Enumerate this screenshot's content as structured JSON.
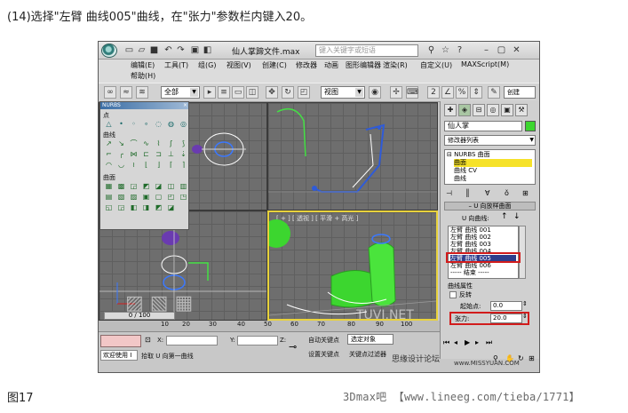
{
  "caption": "(14)选择\"左臂 曲线005\"曲线，在\"张力\"参数栏内键入20。",
  "figure_label": "图17",
  "footer_watermark": "3Dmax吧 【www.lineeg.com/tieba/1771】",
  "app": {
    "window_title": "仙人掌蹄文件.max",
    "search_placeholder": "键入关键字或短语",
    "menu_row1": [
      "编辑(E)",
      "工具(T)",
      "组(G)",
      "视图(V)",
      "创建(C)",
      "修改器",
      "动画",
      "图形编辑器",
      "渲染(R)",
      "自定义(U)",
      "MAXScript(M)"
    ],
    "menu_row2": [
      "帮助(H)"
    ],
    "toolbar": {
      "filter_dropdown": "全部",
      "viewport_dropdown": "视图",
      "named_selection": "创建"
    },
    "nurbs_panel": {
      "title": "NURBS",
      "close": "×",
      "section_point": "点",
      "section_curve": "曲线",
      "section_surface": "曲面"
    },
    "viewports": {
      "perspective_label": "[ + ] [ 透视 ] [ 平滑 + 高光 ]",
      "frame_counter": "0 / 100"
    },
    "command_panel": {
      "object_name": "仙人掌",
      "modifier_list": "修改器列表",
      "stack": [
        "NURBS 曲面",
        "曲面",
        "曲线 CV",
        "曲线"
      ],
      "stack_selected_index": 1,
      "rollout_title": "U 向放样曲面",
      "u_curves_label": "U 向曲线:",
      "curve_list": [
        "左臂 曲线 001",
        "左臂 曲线 002",
        "左臂 曲线 003",
        "左臂 曲线 004",
        "左臂 曲线 005",
        "左臂 曲线 006",
        "----- 结束 -----"
      ],
      "curve_selected_index": 4,
      "curve_props": "曲线属性",
      "reverse_label": "反转",
      "start_point_label": "起始点:",
      "start_point_value": "0.0",
      "tension_label": "张力:",
      "tension_value": "20.0"
    },
    "timeline_ticks": [
      "10",
      "20",
      "30",
      "40",
      "50",
      "60",
      "70",
      "80",
      "90",
      "100"
    ],
    "status": {
      "welcome": "欢迎使用 I",
      "prompt": "拾取 U 向第一曲线",
      "x_label": "X:",
      "y_label": "Y:",
      "z_label": "Z:",
      "autokey": "自动关键点",
      "select_dropdown": "选定对象",
      "setkey": "设置关键点",
      "keyfilter": "关键点过滤器"
    },
    "overlay_watermarks": {
      "site_logo": "TUVI.NET",
      "site_logo_cn": "思缘设计论坛",
      "site_url": "www.MISSYUAN.COM"
    },
    "colors": {
      "selection_yellow": "#f6e22a",
      "selected_curve_blue": "#2d3d8c",
      "highlight_red": "#d21c1c",
      "active_viewport_border": "#e8d23c",
      "cactus_green": "#3cd62f"
    }
  }
}
